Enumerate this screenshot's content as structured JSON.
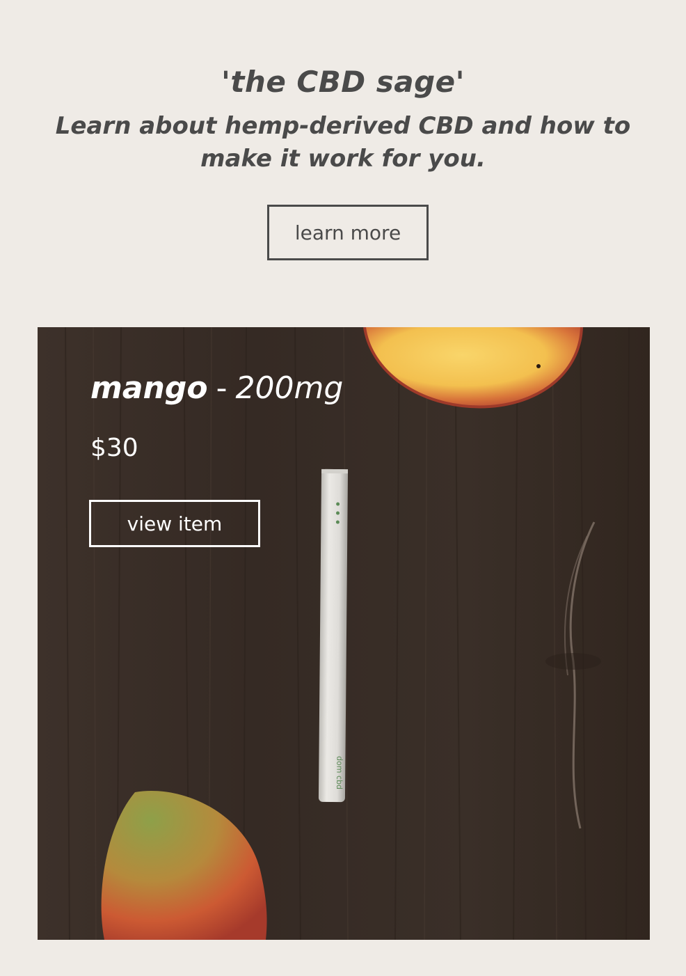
{
  "hero": {
    "title": "'the CBD sage'",
    "subtitle": "Learn about hemp-derived CBD and how to make it work for you.",
    "cta_label": "learn more"
  },
  "product": {
    "flavor": "mango",
    "separator": "-",
    "dose": "200mg",
    "price": "$30",
    "cta_label": "view item",
    "image": "mango-vape-pen-on-wood-photo",
    "pen_brand": "dom cbd"
  },
  "colors": {
    "page_background": "#efebe6",
    "text_primary": "#4a4a4a",
    "card_background": "#3b3029",
    "card_text": "#ffffff"
  }
}
